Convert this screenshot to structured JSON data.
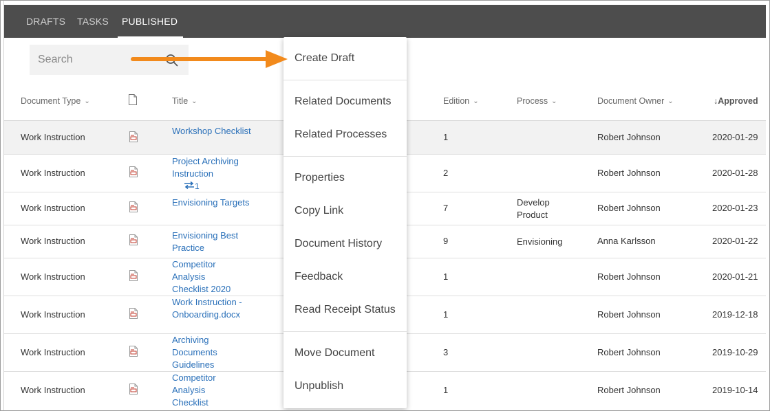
{
  "tabs": [
    {
      "label": "DRAFTS",
      "active": false
    },
    {
      "label": "TASKS",
      "active": false
    },
    {
      "label": "PUBLISHED",
      "active": true
    }
  ],
  "search": {
    "placeholder": "Search"
  },
  "columns": {
    "document_type": "Document Type",
    "title": "Title",
    "edition": "Edition",
    "process": "Process",
    "document_owner": "Document Owner",
    "approved": "Approved"
  },
  "rows": [
    {
      "type": "Work Instruction",
      "title": "Workshop Checklist",
      "edition": "1",
      "process": "",
      "owner": "Robert Johnson",
      "approved": "2020-01-29",
      "relations": ""
    },
    {
      "type": "Work Instruction",
      "title": "Project Archiving Instruction",
      "edition": "2",
      "process": "",
      "owner": "Robert Johnson",
      "approved": "2020-01-28",
      "relations": "1"
    },
    {
      "type": "Work Instruction",
      "title": "Envisioning Targets",
      "edition": "7",
      "process": "Develop Product",
      "owner": "Robert Johnson",
      "approved": "2020-01-23",
      "relations": ""
    },
    {
      "type": "Work Instruction",
      "title": "Envisioning Best Practice",
      "edition": "9",
      "process": "Envisioning",
      "owner": "Anna Karlsson",
      "approved": "2020-01-22",
      "relations": ""
    },
    {
      "type": "Work Instruction",
      "title": "Competitor Analysis Checklist 2020",
      "edition": "1",
      "process": "",
      "owner": "Robert Johnson",
      "approved": "2020-01-21",
      "relations": ""
    },
    {
      "type": "Work Instruction",
      "title": "Work Instruction - Onboarding.docx",
      "edition": "1",
      "process": "",
      "owner": "Robert Johnson",
      "approved": "2019-12-18",
      "relations": ""
    },
    {
      "type": "Work Instruction",
      "title": "Archiving Documents Guidelines",
      "edition": "3",
      "process": "",
      "owner": "Robert Johnson",
      "approved": "2019-10-29",
      "relations": ""
    },
    {
      "type": "Work Instruction",
      "title": "Competitor Analysis Checklist",
      "edition": "1",
      "process": "",
      "owner": "Robert Johnson",
      "approved": "2019-10-14",
      "relations": ""
    }
  ],
  "menu": {
    "create_draft": "Create Draft",
    "related_documents": "Related Documents",
    "related_processes": "Related Processes",
    "properties": "Properties",
    "copy_link": "Copy Link",
    "document_history": "Document History",
    "feedback": "Feedback",
    "read_receipt_status": "Read Receipt Status",
    "move_document": "Move Document",
    "unpublish": "Unpublish"
  },
  "colors": {
    "tabbar": "#4d4d4d",
    "link": "#2a70b9",
    "arrow": "#f28a1c",
    "pdf": "#c0392b",
    "highlight_row": "#f2f2f2"
  },
  "icons": {
    "sort": "chevron-down-icon",
    "document_column": "document-icon",
    "file": "pdf-file-icon",
    "search": "search-icon",
    "relations": "relation-arrows-icon"
  }
}
